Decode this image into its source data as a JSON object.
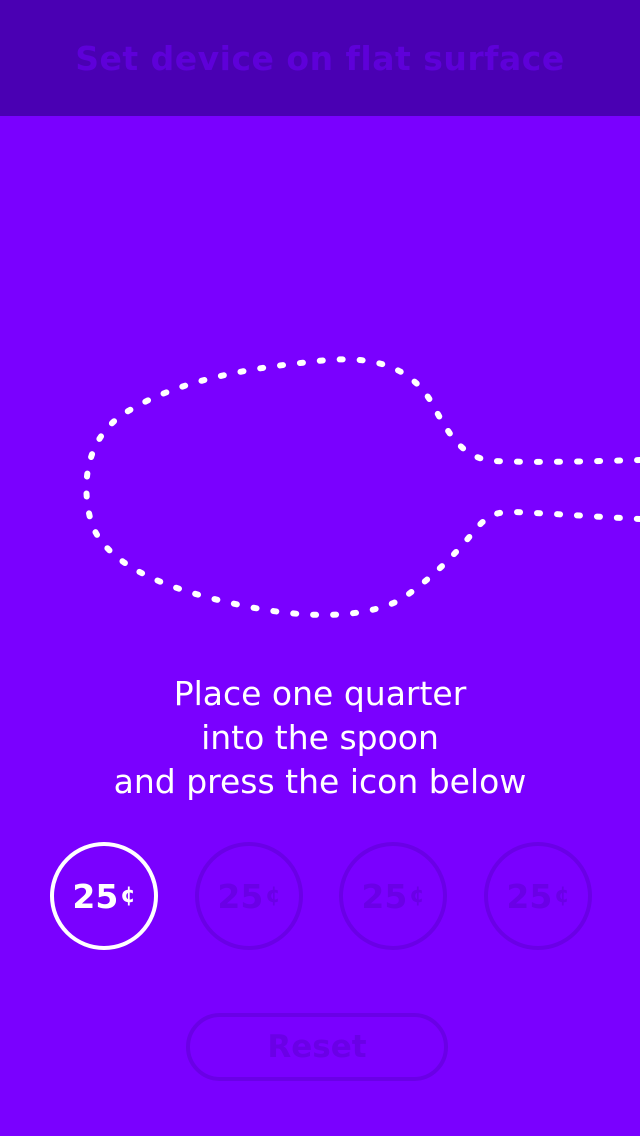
{
  "header": {
    "title": "Set device on flat surface"
  },
  "instruction": {
    "line1": "Place one quarter",
    "line2": "into the spoon",
    "line3": "and press the icon below"
  },
  "coins": [
    {
      "amount": "25",
      "unit": "¢",
      "state": "active"
    },
    {
      "amount": "25",
      "unit": "¢",
      "state": "disabled"
    },
    {
      "amount": "25",
      "unit": "¢",
      "state": "disabled"
    },
    {
      "amount": "25",
      "unit": "¢",
      "state": "disabled"
    }
  ],
  "reset": {
    "label": "Reset"
  },
  "colors": {
    "background": "#7a00ff",
    "header_bg": "#4a00b3",
    "active": "#ffffff",
    "disabled": "#6a00e6"
  },
  "icons": {
    "spoon": "spoon-outline-icon"
  }
}
